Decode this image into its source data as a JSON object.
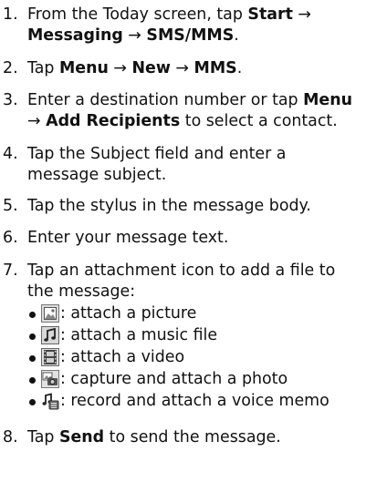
{
  "steps": [
    {
      "number": "1.",
      "parts": [
        "From the Today screen, tap ",
        "Start",
        " → ",
        "Messaging",
        " → ",
        "SMS/MMS",
        "."
      ]
    },
    {
      "number": "2.",
      "parts": [
        "Tap ",
        "Menu",
        " → ",
        "New",
        " → ",
        "MMS",
        "."
      ]
    },
    {
      "number": "3.",
      "parts": [
        "Enter a destination number or tap ",
        "Menu",
        " → ",
        "Add Recipients",
        " to select a contact."
      ]
    },
    {
      "number": "4.",
      "parts": [
        "Tap the Subject field and enter a",
        "message subject."
      ]
    },
    {
      "number": "5.",
      "text": "Tap the stylus in the message body."
    },
    {
      "number": "6.",
      "text": "Enter your message text."
    },
    {
      "number": "7.",
      "parts": [
        "Tap an attachment icon to add a file to",
        "the message:"
      ]
    },
    {
      "number": "8.",
      "parts": [
        "Tap ",
        "Send",
        " to send the message."
      ]
    }
  ],
  "attachments": [
    {
      "icon": "picture-icon",
      "label": ": attach a picture"
    },
    {
      "icon": "music-file-icon",
      "label": ": attach a music file"
    },
    {
      "icon": "video-icon",
      "label": ": attach a video"
    },
    {
      "icon": "camera-photo-icon",
      "label": ": capture and attach a photo"
    },
    {
      "icon": "voice-memo-icon",
      "label": ": record and attach a voice memo"
    }
  ]
}
